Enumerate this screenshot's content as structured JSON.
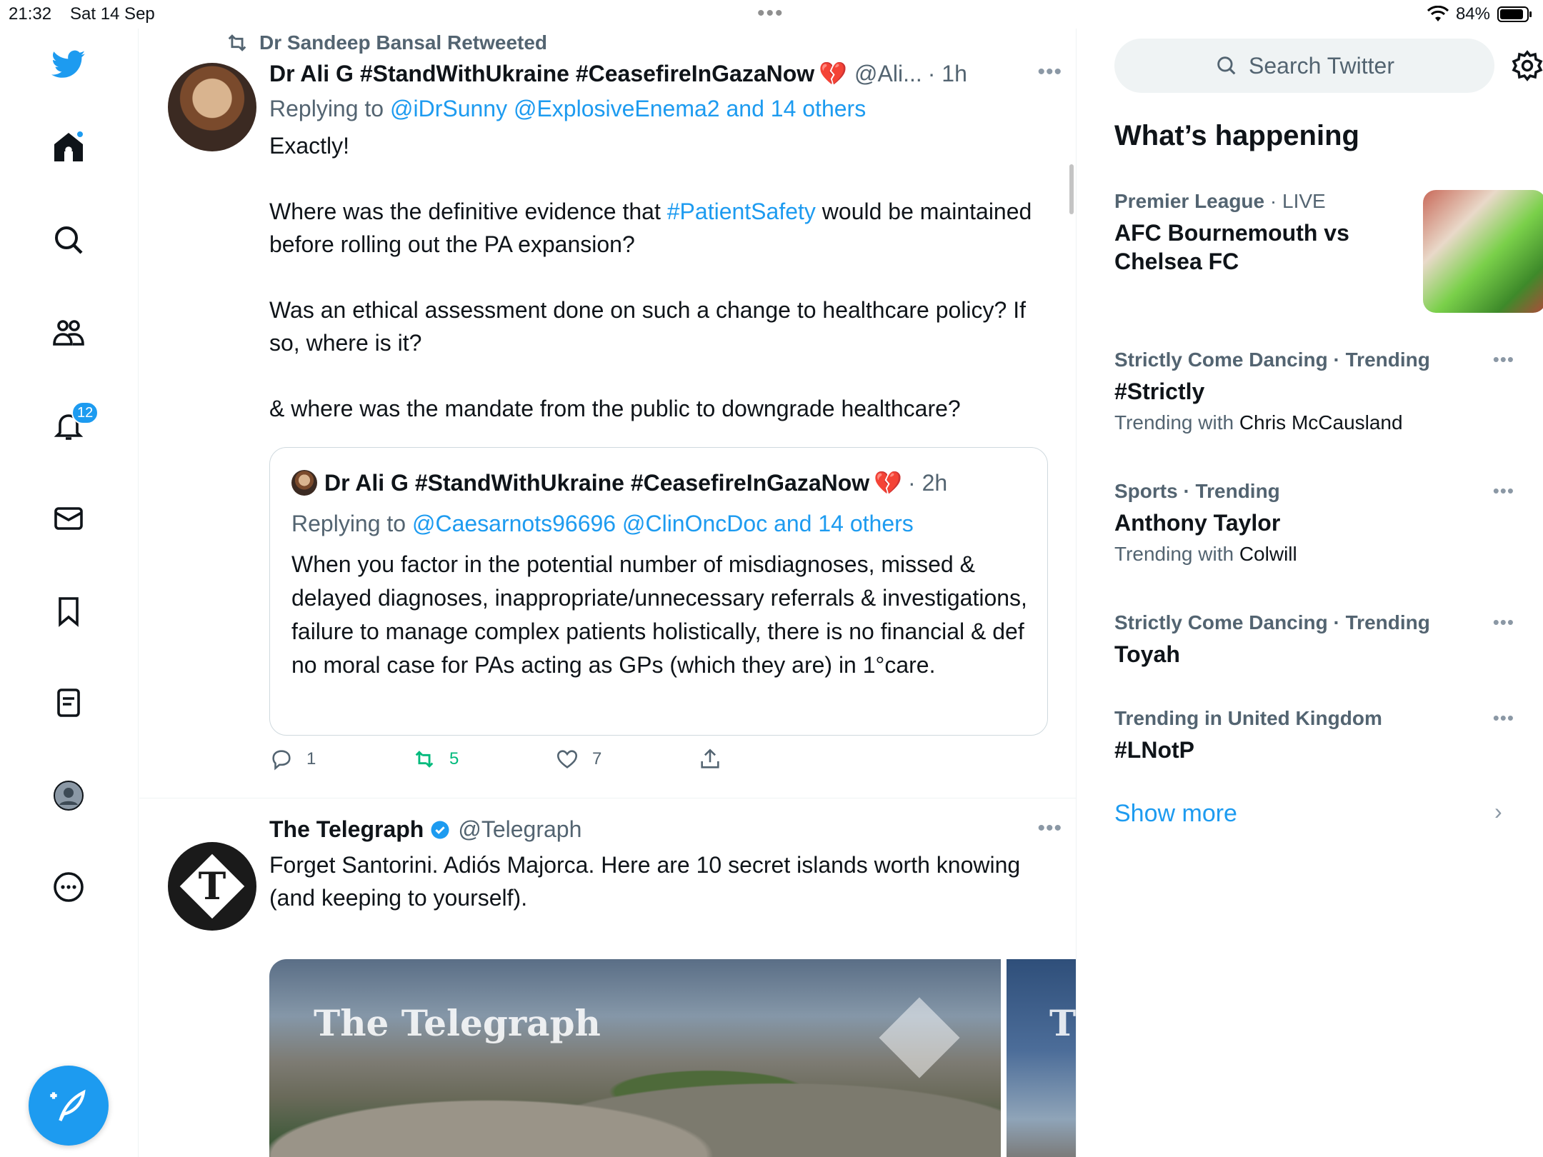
{
  "status_bar": {
    "time": "21:32",
    "date": "Sat 14 Sep",
    "battery": "84%"
  },
  "sidebar": {
    "notifications_badge": "12"
  },
  "tweets": [
    {
      "retweeted_by": "Dr Sandeep Bansal Retweeted",
      "name": "Dr Ali G #StandWithUkraine #CeasefireInGazaNow",
      "emoji": "💔",
      "handle": "@Ali...",
      "time": "· 1h",
      "reply_prefix": "Replying to",
      "reply_targets": "@iDrSunny @ExplosiveEnema2 and 14 others",
      "body_lines": [
        "Exactly!",
        "",
        "Where was the definitive evidence that ",
        "#PatientSafety",
        " would be maintained before rolling out the PA expansion?",
        "",
        "Was an ethical assessment done on such a change to healthcare policy? If so, where is it?",
        "",
        "& where was the mandate from the public to downgrade healthcare?"
      ],
      "quote": {
        "name": "Dr Ali G #StandWithUkraine #CeasefireInGazaNow",
        "emoji": "💔",
        "time": "· 2h",
        "reply_prefix": "Replying to",
        "reply_targets": "@Caesarnots96696 @ClinOncDoc and 14 others",
        "body": "When you factor in the potential number of misdiagnoses, missed & delayed diagnoses, inappropriate/unnecessary referrals & investigations, failure to manage complex patients holistically, there is no financial & def no moral case for PAs acting as GPs (which they are) in 1°care."
      },
      "actions": {
        "replies": "1",
        "retweets": "5",
        "likes": "7"
      }
    },
    {
      "name": "The Telegraph",
      "handle": "@Telegraph",
      "body": "Forget Santorini. Adiós Majorca. Here are 10 secret islands worth knowing (and keeping to yourself).",
      "media_title": "The Telegraph"
    }
  ],
  "right": {
    "search_placeholder": "Search Twitter",
    "section_title": "What’s happening",
    "trends": [
      {
        "category": "Premier League",
        "live": " · LIVE",
        "name": "AFC Bournemouth vs Chelsea FC",
        "with_label": "",
        "with_value": ""
      },
      {
        "category": "Strictly Come Dancing · Trending",
        "live": "",
        "name": "#Strictly",
        "with_label": "Trending with ",
        "with_value": "Chris McCausland"
      },
      {
        "category": "Sports · Trending",
        "live": "",
        "name": "Anthony Taylor",
        "with_label": "Trending with ",
        "with_value": "Colwill"
      },
      {
        "category": "Strictly Come Dancing · Trending",
        "live": "",
        "name": "Toyah",
        "with_label": "",
        "with_value": ""
      },
      {
        "category": "Trending in United Kingdom",
        "live": "",
        "name": "#LNotP",
        "with_label": "",
        "with_value": ""
      }
    ],
    "show_more": "Show more"
  },
  "colors": {
    "accent": "#1d9bf0",
    "retweet_green": "#00ba7c",
    "secondary_text": "#536471"
  }
}
